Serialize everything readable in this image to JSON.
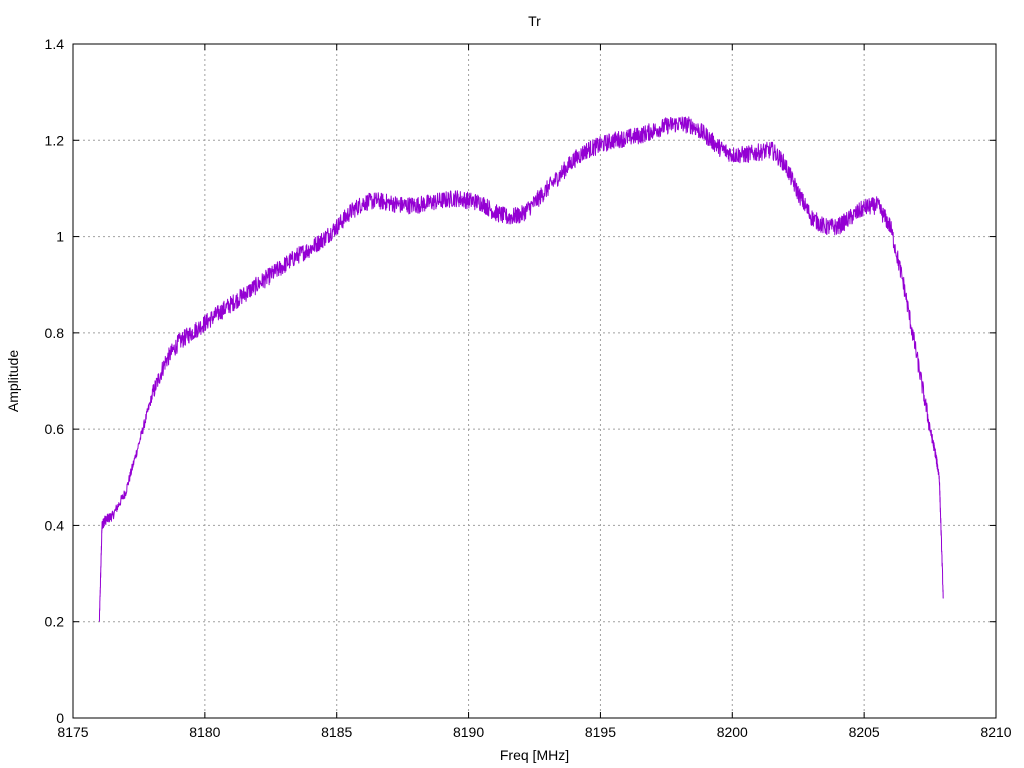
{
  "chart_data": {
    "type": "line",
    "title": "Tr",
    "xlabel": "Freq [MHz]",
    "ylabel": "Amplitude",
    "xlim": [
      8175,
      8210
    ],
    "ylim": [
      0,
      1.4
    ],
    "xticks": [
      8175,
      8180,
      8185,
      8190,
      8195,
      8200,
      8205,
      8210
    ],
    "yticks": [
      0,
      0.2,
      0.4,
      0.6,
      0.8,
      1,
      1.2,
      1.4
    ],
    "xtick_labels": [
      "8175",
      "8180",
      "8185",
      "8190",
      "8195",
      "8200",
      "8205",
      "8210"
    ],
    "ytick_labels": [
      "0",
      "0.2",
      "0.4",
      "0.6",
      "0.8",
      "1",
      "1.2",
      "1.4"
    ],
    "grid": true,
    "colors": {
      "series": "#9400d3",
      "grid": "#a0a0a0",
      "axis": "#000000"
    },
    "series": [
      {
        "x": [
          8176.0,
          8176.1,
          8176.2,
          8176.5,
          8177.0,
          8177.5,
          8178.0,
          8178.5,
          8179.0,
          8179.5,
          8180.0,
          8180.5,
          8181.0,
          8181.5,
          8182.0,
          8182.5,
          8183.0,
          8183.5,
          8184.0,
          8184.5,
          8185.0,
          8185.5,
          8186.0,
          8186.5,
          8187.0,
          8187.5,
          8188.0,
          8188.5,
          8189.0,
          8189.5,
          8190.0,
          8190.5,
          8191.0,
          8191.5,
          8192.0,
          8192.5,
          8193.0,
          8193.5,
          8194.0,
          8194.5,
          8195.0,
          8195.5,
          8196.0,
          8196.5,
          8197.0,
          8197.5,
          8198.0,
          8198.5,
          8199.0,
          8199.5,
          8200.0,
          8200.5,
          8201.0,
          8201.5,
          8202.0,
          8202.5,
          8203.0,
          8203.5,
          8204.0,
          8204.5,
          8205.0,
          8205.5,
          8206.0,
          8206.5,
          8207.0,
          8207.5,
          8207.7,
          8207.85,
          8208.0
        ],
        "y": [
          0.2,
          0.4,
          0.41,
          0.42,
          0.47,
          0.57,
          0.67,
          0.74,
          0.78,
          0.8,
          0.82,
          0.84,
          0.86,
          0.88,
          0.9,
          0.92,
          0.94,
          0.96,
          0.975,
          0.995,
          1.02,
          1.05,
          1.07,
          1.075,
          1.07,
          1.065,
          1.065,
          1.07,
          1.075,
          1.08,
          1.075,
          1.07,
          1.05,
          1.04,
          1.045,
          1.07,
          1.1,
          1.13,
          1.16,
          1.18,
          1.19,
          1.2,
          1.205,
          1.21,
          1.22,
          1.23,
          1.235,
          1.23,
          1.21,
          1.185,
          1.17,
          1.17,
          1.175,
          1.18,
          1.15,
          1.09,
          1.04,
          1.02,
          1.02,
          1.04,
          1.06,
          1.065,
          1.02,
          0.9,
          0.75,
          0.6,
          0.55,
          0.5,
          0.25
        ]
      }
    ]
  }
}
